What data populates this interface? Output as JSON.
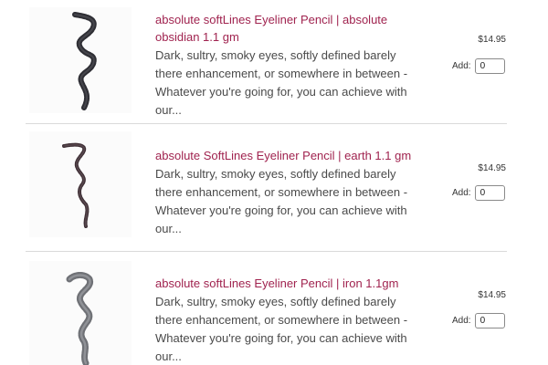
{
  "products": [
    {
      "title": "absolute softLines Eyeliner Pencil | absolute obsidian 1.1 gm",
      "description": "Dark, sultry, smoky eyes, softly defined barely there enhancement, or somewhere in between - Whatever you're going for, you can achieve with our...",
      "price": "$14.95",
      "add_label": "Add:",
      "quantity": "0",
      "swatch_color": "#2e2e34",
      "swatch_icon": "eyeliner-swatch-icon"
    },
    {
      "title": "absolute SoftLines Eyeliner Pencil | earth 1.1 gm",
      "description": "Dark, sultry, smoky eyes, softly defined barely there enhancement, or somewhere in between - Whatever you're going for, you can achieve with our...",
      "price": "$14.95",
      "add_label": "Add:",
      "quantity": "0",
      "swatch_color": "#3f3036",
      "swatch_icon": "eyeliner-swatch-icon"
    },
    {
      "title": "absolute softLines Eyeliner Pencil | iron 1.1gm",
      "description": "Dark, sultry, smoky eyes, softly defined barely there enhancement, or somewhere in between - Whatever you're going for, you can achieve with our...",
      "price": "$14.95",
      "add_label": "Add:",
      "quantity": "0",
      "swatch_color": "#6f7176",
      "swatch_icon": "eyeliner-swatch-icon"
    }
  ],
  "colors": {
    "title": "#a0234f",
    "description": "#4a4a4a",
    "divider": "#dadada"
  }
}
